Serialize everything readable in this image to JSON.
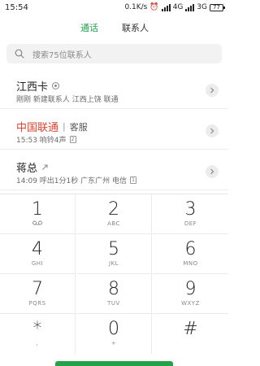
{
  "status": {
    "time": "15:54",
    "speed": "0.1K/s",
    "net1": "4G",
    "net2": "3G",
    "battery": "77"
  },
  "tabs": [
    {
      "label": "通话"
    },
    {
      "label": "联系人"
    }
  ],
  "search": {
    "placeholder": "搜索75位联系人",
    "icon": "search-icon"
  },
  "calls": [
    {
      "name": "江西卡",
      "detail": "刚刚 新建联系人 江西上饶 联通",
      "icon": "sim-icon"
    },
    {
      "name": "中国联通",
      "tag": "客服",
      "detail": "15:53 响铃4声",
      "sim": "2",
      "name_color": "#e0432c"
    },
    {
      "name": "蒋总",
      "detail": "14:09 呼出1分1秒 广东广州 电信",
      "sim": "1",
      "icon": "outgoing-call-icon"
    }
  ],
  "keypad": [
    {
      "digit": "1",
      "letters": "ᦞ"
    },
    {
      "digit": "2",
      "letters": "ABC"
    },
    {
      "digit": "3",
      "letters": "DEF"
    },
    {
      "digit": "4",
      "letters": "GHI"
    },
    {
      "digit": "5",
      "letters": "JKL"
    },
    {
      "digit": "6",
      "letters": "MNO"
    },
    {
      "digit": "7",
      "letters": "PQRS"
    },
    {
      "digit": "8",
      "letters": "TUV"
    },
    {
      "digit": "9",
      "letters": "WXYZ"
    },
    {
      "digit": "*",
      "letters": ","
    },
    {
      "digit": "0",
      "letters": "+"
    },
    {
      "digit": "#",
      "letters": ""
    }
  ],
  "colors": {
    "accent": "#22a34a",
    "carrier_red": "#e0432c"
  }
}
